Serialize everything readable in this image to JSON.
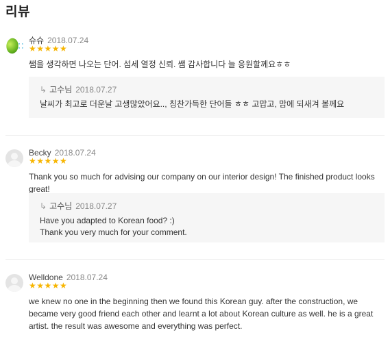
{
  "section": {
    "title": "리뷰"
  },
  "reviews": [
    {
      "author": "슈슈",
      "date": "2018.07.24",
      "stars": "★★★★★",
      "rating": 5,
      "text": "쌤을 생각하면 나오는 단어. 섬세 열정 신뢰. 쌤 감사합니다 늘 응원할께요ㅎㅎ",
      "reply": {
        "arrow": "↳",
        "author": "고수님",
        "date": "2018.07.27",
        "lines": [
          "날씨가 최고로 더운날 고생많았어요.., 칭찬가득한 단어들 ㅎㅎ 고맙고, 맘에 되새겨 볼께요"
        ]
      }
    },
    {
      "author": "Becky",
      "date": "2018.07.24",
      "stars": "★★★★★",
      "rating": 5,
      "text": "Thank you so much for advising our company on our interior design! The finished product looks great!",
      "reply": {
        "arrow": "↳",
        "author": "고수님",
        "date": "2018.07.27",
        "lines": [
          "Have you adapted to Korean food? :)",
          "Thank you very much for your comment."
        ]
      }
    },
    {
      "author": "Welldone",
      "date": "2018.07.24",
      "stars": "★★★★★",
      "rating": 5,
      "text": "we knew no one in the beginning then we found this Korean guy. after the construction, we became very good friend each other and learnt a lot about Korean culture as well. he is a great artist. the result was awesome and everything was perfect."
    }
  ]
}
